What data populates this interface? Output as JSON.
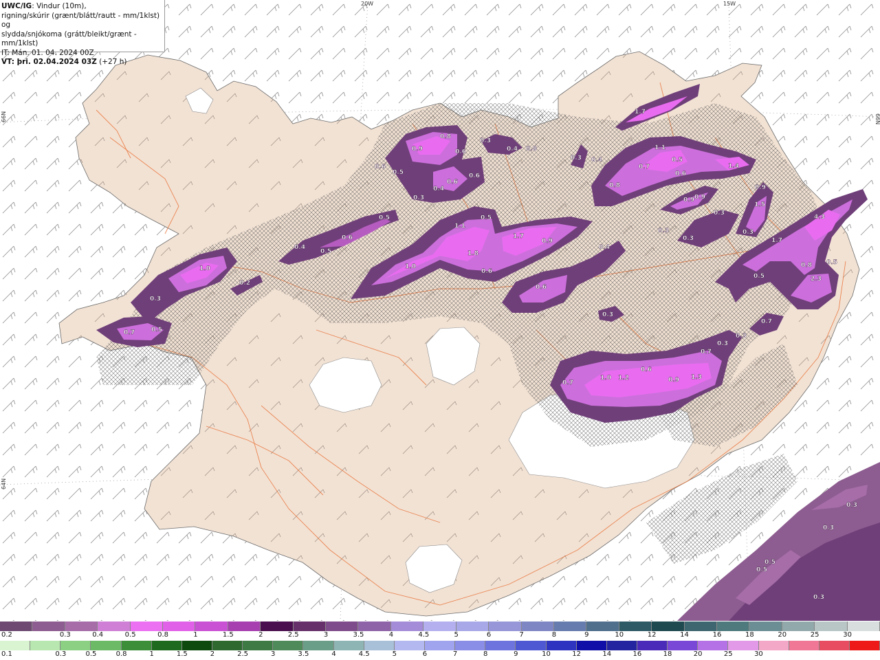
{
  "header": {
    "brand": "UWC/IG",
    "title_rest": ": Vindur (10m),",
    "line2": "rigning/skúrir (grænt/blátt/rautt - mm/1klst) og",
    "line3": "slydda/snjókoma (grátt/bleikt/grænt - mm/1klst)",
    "issue_time": "IT: Mán. 01. 04. 2024 00Z",
    "valid_label": "VT: þri. 02.04.2024 03Z",
    "valid_offset": " (+27 h)"
  },
  "graticule": {
    "top_labels": [
      "20W",
      "15W"
    ],
    "left_labels": [
      "66N",
      "64N"
    ],
    "right_labels": [
      "66N"
    ]
  },
  "colors": {
    "land": "#f2e2d4",
    "sea": "#ffffff",
    "glacier": "#ffffff",
    "roads": "#e8743a",
    "pale": "#e4aee4",
    "light": "#cc6fdc",
    "magenta": "#e96cf0",
    "dark": "#6f3f79"
  },
  "precip_labels": [
    "1.7",
    "0.9",
    "0.8",
    "0.6",
    "0.3",
    "0.4",
    "0.8",
    "0.3",
    "0.6",
    "0.4",
    "0.5",
    "0.6",
    "1.1",
    "0.7",
    "0.5",
    "0.6",
    "1.4",
    "0.3",
    "0.8",
    "0.9",
    "0.9",
    "1.5",
    "0.5",
    "0.6",
    "0.4",
    "1.1",
    "0.5",
    "1.8",
    "1.7",
    "0.9",
    "0.3",
    "0.3",
    "0.3",
    "4.3",
    "1.0",
    "0.6",
    "0.4",
    "1.7",
    "0.6",
    "0.5",
    "0.9",
    "1.0",
    "0.2",
    "0.3",
    "0.6",
    "0.5",
    "0.4",
    "2.3",
    "0.8",
    "0.5",
    "0.3",
    "0.3",
    "0.7",
    "0.7",
    "1.0",
    "1.2",
    "0.6",
    "0.9",
    "1.3",
    "0.3",
    "0.3",
    "0.5",
    "0.3"
  ],
  "colorbar_upper": {
    "colors": [
      "#6e4a72",
      "#8d5c90",
      "#a66da8",
      "#cf7fd6",
      "#ec71f2",
      "#e060e8",
      "#c952d4",
      "#a73fb0",
      "#4a0f4e",
      "#66306a",
      "#7e4c8a",
      "#8f63a8",
      "#a58cd8",
      "#b4b0ef",
      "#a8a8e8",
      "#9696d8",
      "#7f86c4",
      "#667cae",
      "#4f6f8c",
      "#2e5a66",
      "#1f4a50",
      "#3e6670",
      "#4e7a7e",
      "#6a8e94",
      "#92a9ab",
      "#b8c6c6",
      "#d8dede"
    ],
    "ticks": [
      "0.2",
      "0.3",
      "0.4",
      "0.5",
      "0.8",
      "1",
      "1.5",
      "2",
      "2.5",
      "3",
      "3.5",
      "4",
      "4.5",
      "5",
      "6",
      "7",
      "8",
      "9",
      "10",
      "12",
      "14",
      "16",
      "18",
      "20",
      "25",
      "30"
    ]
  },
  "colorbar_lower": {
    "colors": [
      "#d8f4d0",
      "#b8e8b0",
      "#8cd084",
      "#6cba66",
      "#3c8e38",
      "#1e6a1e",
      "#0e4a0e",
      "#2e6a30",
      "#3e7a44",
      "#4e8a5a",
      "#6a9e88",
      "#8eb4b4",
      "#a8c0d8",
      "#b4b8f0",
      "#a0a4ee",
      "#8a8ee6",
      "#6e74de",
      "#4e58d2",
      "#2e34c0",
      "#1010a8",
      "#2424a0",
      "#4a2ab8",
      "#7a48d6",
      "#b472e6",
      "#e29ae8",
      "#f4a8c8",
      "#f07896",
      "#e84c60",
      "#ee1a1a"
    ],
    "ticks": [
      "0.1",
      "0.3",
      "0.5",
      "0.8",
      "1",
      "1.5",
      "2",
      "2.5",
      "3",
      "3.5",
      "4",
      "4.5",
      "5",
      "6",
      "7",
      "8",
      "9",
      "10",
      "12",
      "14",
      "16",
      "18",
      "20",
      "25",
      "30"
    ]
  }
}
